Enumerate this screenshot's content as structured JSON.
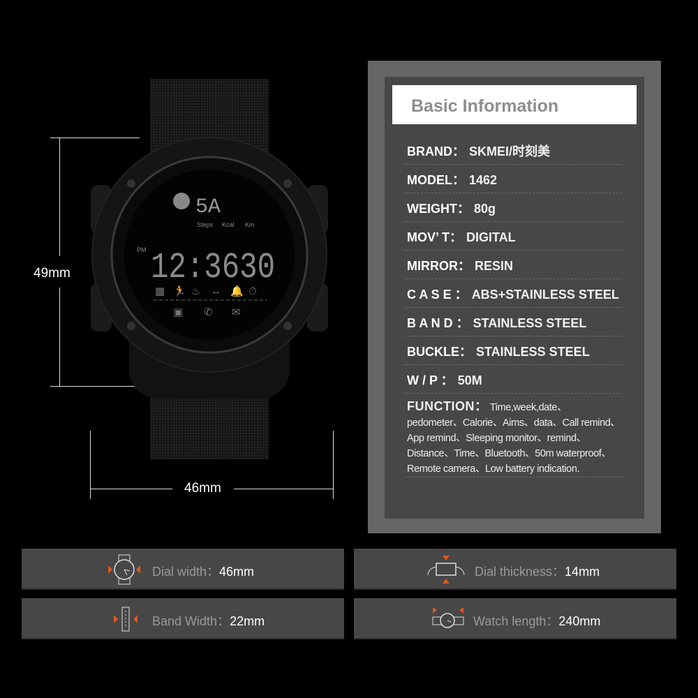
{
  "dimensions": {
    "height": "49mm",
    "width": "46mm"
  },
  "watch_display": {
    "top_digits": "5A",
    "labels": [
      "Steps",
      "Kcal",
      "Km"
    ],
    "am_pm": "PM",
    "time": "12:3630"
  },
  "basic_info": {
    "title": "Basic Information",
    "rows": [
      {
        "key": "BRAND：",
        "value": "SKMEI/时刻美"
      },
      {
        "key": "MODEL：",
        "value": "1462"
      },
      {
        "key": "WEIGHT：",
        "value": "80g"
      },
      {
        "key": "MOV’ T：",
        "value": "DIGITAL"
      },
      {
        "key": "MIRROR：",
        "value": "RESIN"
      },
      {
        "key": "C A S E ：",
        "value": "ABS+STAINLESS STEEL"
      },
      {
        "key": "B A N D ：",
        "value": "STAINLESS STEEL"
      },
      {
        "key": "BUCKLE：",
        "value": "STAINLESS STEEL"
      },
      {
        "key": "W / P ：",
        "value": "50M"
      }
    ],
    "function": {
      "key": "FUNCTION：",
      "value": "Time,week,date、pedometer、Calorie、Aims、data、Call remind、App remind、Sleeping monitor、remind、Distance、Time、Bluetooth、50m waterproof、Remote camera、Low battery indication."
    }
  },
  "specs": [
    {
      "label": "Dial width：",
      "value": "46mm",
      "icon": "watch-face-icon"
    },
    {
      "label": "Dial thickness：",
      "value": "14mm",
      "icon": "watch-side-icon"
    },
    {
      "label": "Band Width：",
      "value": "22mm",
      "icon": "band-icon"
    },
    {
      "label": "Watch length：",
      "value": "240mm",
      "icon": "watch-strap-icon"
    }
  ],
  "colors": {
    "accent": "#e0561e",
    "panel": "#474747",
    "panel_outer": "#666666"
  }
}
